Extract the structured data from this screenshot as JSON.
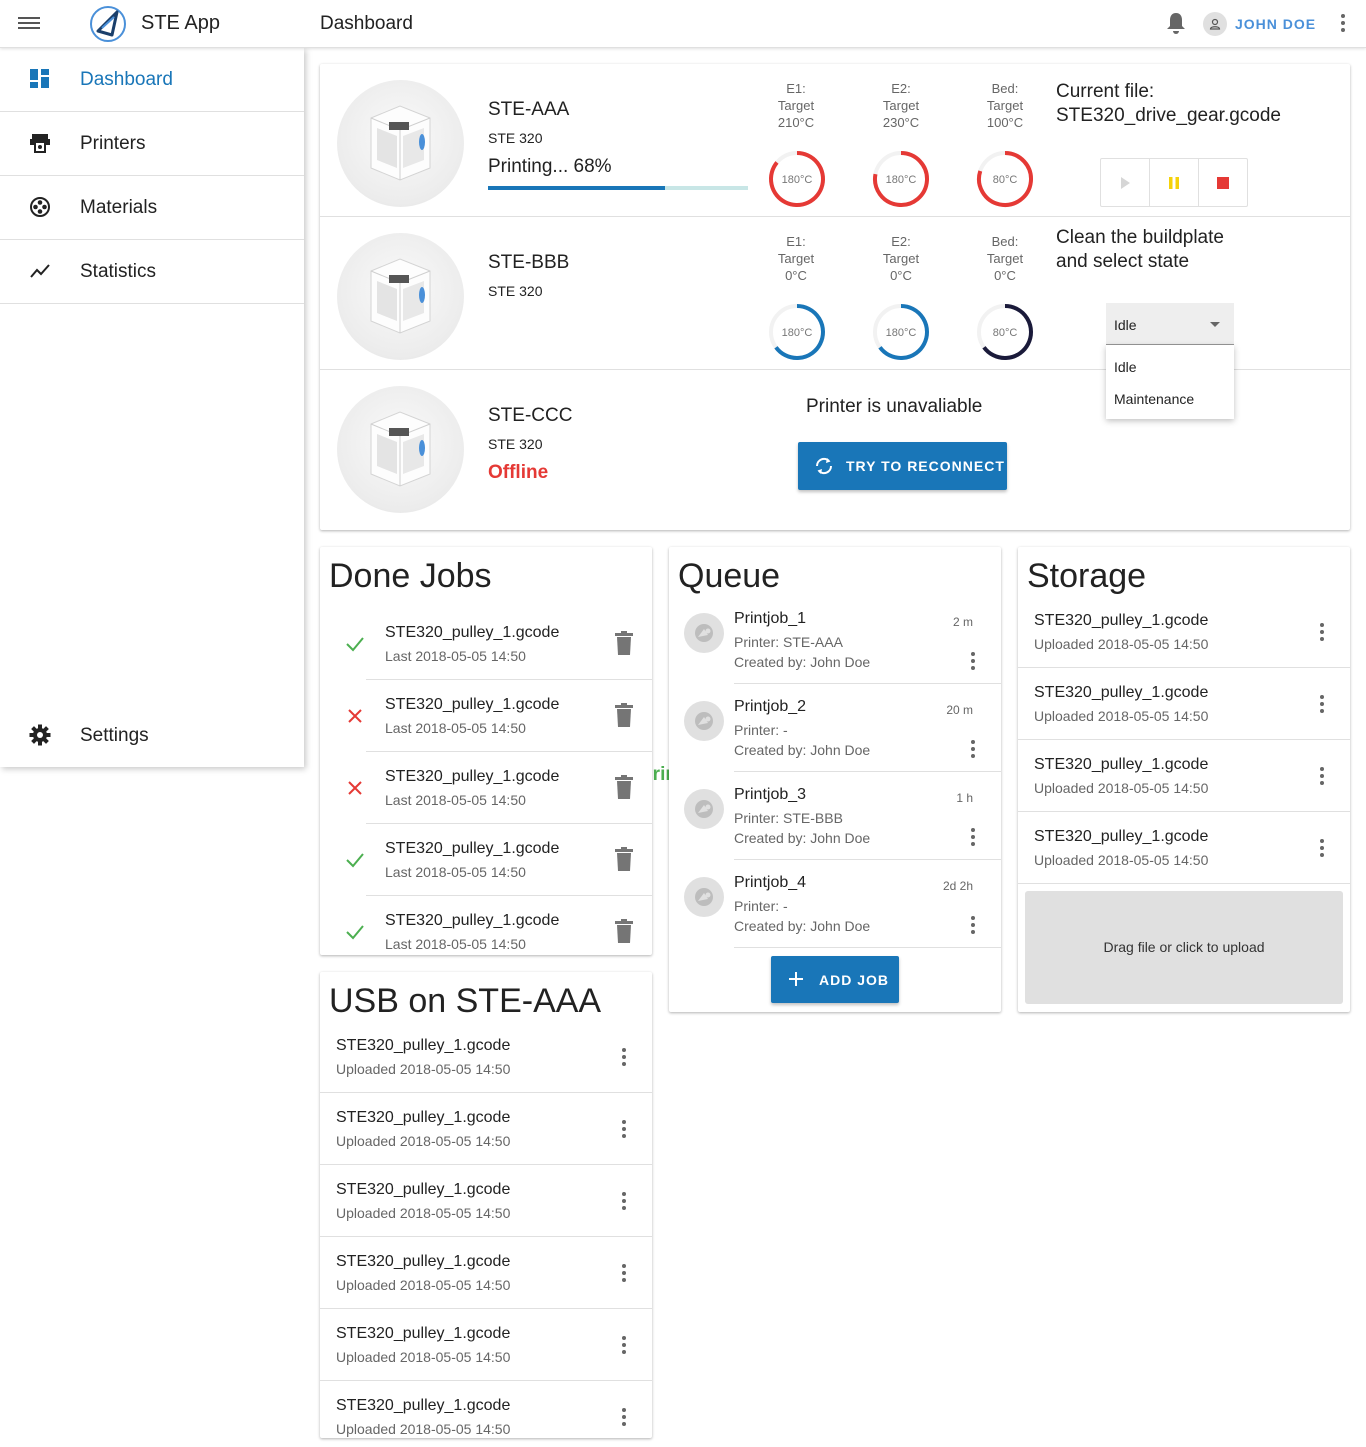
{
  "app": {
    "title": "STE App",
    "page_title": "Dashboard",
    "user_name": "JOHN DOE",
    "accent": "#1976b8"
  },
  "sidebar": {
    "items": [
      {
        "label": "Dashboard",
        "icon": "dashboard-icon",
        "active": true
      },
      {
        "label": "Printers",
        "icon": "printer-icon"
      },
      {
        "label": "Materials",
        "icon": "materials-reel-icon"
      },
      {
        "label": "Statistics",
        "icon": "chart-line-icon"
      }
    ],
    "settings_label": "Settings"
  },
  "printers": [
    {
      "name": "STE-AAA",
      "model": "STE 320",
      "status": "Printing... 68%",
      "progress": 0.68,
      "temps": [
        {
          "label": "E1:",
          "target_label": "Target",
          "target": "210°C",
          "current": "180°C",
          "fraction": 0.86,
          "color": "#e53935"
        },
        {
          "label": "E2:",
          "target_label": "Target",
          "target": "230°C",
          "current": "180°C",
          "fraction": 0.78,
          "color": "#e53935"
        },
        {
          "label": "Bed:",
          "target_label": "Target",
          "target": "100°C",
          "current": "80°C",
          "fraction": 0.8,
          "color": "#e53935"
        }
      ],
      "file_label": "Current file:",
      "file_name": "STE320_drive_gear.gcode"
    },
    {
      "name": "STE-BBB",
      "model": "STE 320",
      "status": "Printing Done!",
      "temps": [
        {
          "label": "E1:",
          "target_label": "Target",
          "target": "0°C",
          "current": "180°C",
          "fraction": 0.65,
          "color": "#1976b8"
        },
        {
          "label": "E2:",
          "target_label": "Target",
          "target": "0°C",
          "current": "180°C",
          "fraction": 0.65,
          "color": "#1976b8"
        },
        {
          "label": "Bed:",
          "target_label": "Target",
          "target": "0°C",
          "current": "80°C",
          "fraction": 0.65,
          "color": "#1a1a3a"
        }
      ],
      "message_line1": "Clean the buildplate",
      "message_line2": "and select state",
      "state_select": {
        "value": "Idle",
        "options": [
          "Idle",
          "Maintenance"
        ]
      }
    },
    {
      "name": "STE-CCC",
      "model": "STE 320",
      "status": "Offline",
      "message": "Printer is unavaliable",
      "reconnect_label": "TRY TO RECONNECT"
    }
  ],
  "done_jobs": {
    "title": "Done Jobs",
    "items": [
      {
        "file": "STE320_pulley_1.gcode",
        "time": "Last 2018-05-05 14:50",
        "ok": true
      },
      {
        "file": "STE320_pulley_1.gcode",
        "time": "Last 2018-05-05 14:50",
        "ok": false
      },
      {
        "file": "STE320_pulley_1.gcode",
        "time": "Last 2018-05-05 14:50",
        "ok": false
      },
      {
        "file": "STE320_pulley_1.gcode",
        "time": "Last 2018-05-05 14:50",
        "ok": true
      },
      {
        "file": "STE320_pulley_1.gcode",
        "time": "Last 2018-05-05 14:50",
        "ok": true
      }
    ]
  },
  "queue": {
    "title": "Queue",
    "items": [
      {
        "name": "Printjob_1",
        "printer": "Printer: STE-AAA",
        "created": "Created by: John Doe",
        "eta": "2 m"
      },
      {
        "name": "Printjob_2",
        "printer": "Printer: -",
        "created": "Created by: John Doe",
        "eta": "20 m"
      },
      {
        "name": "Printjob_3",
        "printer": "Printer: STE-BBB",
        "created": "Created by: John Doe",
        "eta": "1 h"
      },
      {
        "name": "Printjob_4",
        "printer": "Printer: -",
        "created": "Created by: John Doe",
        "eta": "2d 2h"
      }
    ],
    "add_label": "ADD JOB"
  },
  "storage": {
    "title": "Storage",
    "items": [
      {
        "file": "STE320_pulley_1.gcode",
        "time": "Uploaded 2018-05-05 14:50"
      },
      {
        "file": "STE320_pulley_1.gcode",
        "time": "Uploaded 2018-05-05 14:50"
      },
      {
        "file": "STE320_pulley_1.gcode",
        "time": "Uploaded 2018-05-05 14:50"
      },
      {
        "file": "STE320_pulley_1.gcode",
        "time": "Uploaded 2018-05-05 14:50"
      }
    ],
    "upload_label": "Drag file or click to upload"
  },
  "usb": {
    "title": "USB on STE-AAA",
    "items": [
      {
        "file": "STE320_pulley_1.gcode",
        "time": "Uploaded 2018-05-05 14:50"
      },
      {
        "file": "STE320_pulley_1.gcode",
        "time": "Uploaded 2018-05-05 14:50"
      },
      {
        "file": "STE320_pulley_1.gcode",
        "time": "Uploaded 2018-05-05 14:50"
      },
      {
        "file": "STE320_pulley_1.gcode",
        "time": "Uploaded 2018-05-05 14:50"
      },
      {
        "file": "STE320_pulley_1.gcode",
        "time": "Uploaded 2018-05-05 14:50"
      },
      {
        "file": "STE320_pulley_1.gcode",
        "time": "Uploaded 2018-05-05 14:50"
      }
    ]
  }
}
